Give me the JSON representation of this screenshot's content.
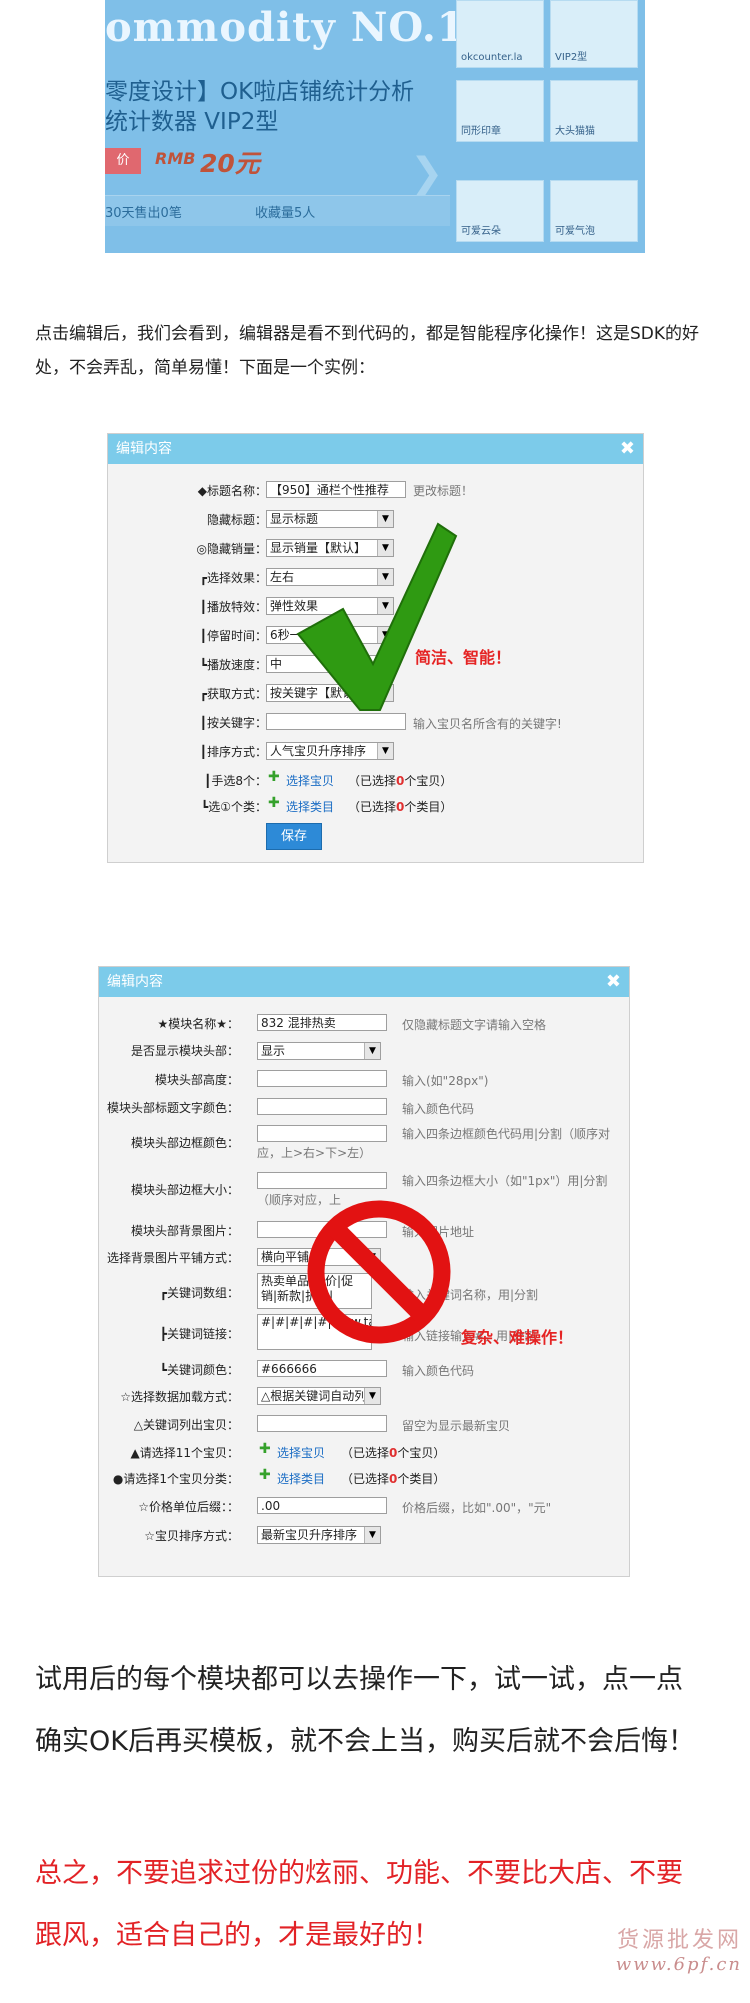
{
  "banner": {
    "title": "ommodity NO.1",
    "subtitle_line1": "零度设计】OK啦店铺统计分析",
    "subtitle_line2": "统计数器 VIP2型",
    "price_tag": "价",
    "price_currency": "RMB",
    "price_value": "20元",
    "sold_text": "30天售出0笔",
    "fav_text": "收藏量5人",
    "thumbs": [
      {
        "label": "okcounter.la"
      },
      {
        "label": "VIP2型"
      },
      {
        "label": "同形印章"
      },
      {
        "label": "大头猫猫"
      },
      {
        "label": "可爱云朵"
      },
      {
        "label": "可爱气泡"
      }
    ]
  },
  "intro_text": "点击编辑后，我们会看到，编辑器是看不到代码的，都是智能程序化操作！这是SDK的好处，不会弄乱，简单易懂！下面是一个实例：",
  "editor1": {
    "header": "编辑内容",
    "close_icon": "close-icon",
    "rows": {
      "title_label": "◆标题名称：",
      "title_value": "【950】通栏个性推荐",
      "title_hint": "更改标题！",
      "hide_title_label": "隐藏标题：",
      "hide_title_value": "显示标题",
      "hide_sales_label": "◎隐藏销量：",
      "hide_sales_value": "显示销量【默认】",
      "effect_label": "┏选择效果：",
      "effect_value": "左右",
      "play_label": "┃播放特效：",
      "play_value": "弹性效果",
      "pause_label": "┃停留时间：",
      "pause_value": "6秒一自",
      "speed_label": "┗播放速度：",
      "speed_value": "中",
      "fetch_label": "┏获取方式：",
      "fetch_value": "按关键字【默认】",
      "keyword_label": "┃按关键字：",
      "keyword_value": "",
      "keyword_hint": "输入宝贝名所含有的关键字!",
      "sort_label": "┃排序方式：",
      "sort_value": "人气宝贝升序排序",
      "pick_items_label": "┃手选8个：",
      "pick_items_link": "选择宝贝",
      "pick_items_count_pre": "（已选择",
      "pick_items_count_num": "0",
      "pick_items_count_post": "个宝贝）",
      "pick_cats_label": "┗选①个类：",
      "pick_cats_link": "选择类目",
      "pick_cats_count_pre": "（已选择",
      "pick_cats_count_num": "0",
      "pick_cats_count_post": "个类目）",
      "save_label": "保存"
    },
    "annotation": "简洁、智能！"
  },
  "editor2": {
    "header": "编辑内容",
    "close_icon": "close-icon",
    "rows": {
      "module_name_label": "★模块名称★：",
      "module_name_value": "832 混排热卖",
      "module_name_hint": "仅隐藏标题文字请输入空格",
      "show_head_label": "是否显示模块头部：",
      "show_head_value": "显示",
      "head_height_label": "模块头部高度：",
      "head_height_value": "",
      "head_height_hint": "输入(如\"28px\")",
      "title_color_label": "模块头部标题文字颜色：",
      "title_color_value": "",
      "title_color_hint": "输入颜色代码",
      "border_color_label": "模块头部边框颜色：",
      "border_color_value": "",
      "border_color_hint": "输入四条边框颜色代码用|分割（顺序对应，上>右>下>左）",
      "border_size_label": "模块头部边框大小：",
      "border_size_value": "",
      "border_size_hint": "输入四条边框大小（如\"1px\"）用|分割（顺序对应，上",
      "bg_image_label": "模块头部背景图片：",
      "bg_image_value": "",
      "bg_image_hint": "输入图片地址",
      "bg_tile_label": "选择背景图片平铺方式：",
      "bg_tile_value": "横向平铺",
      "kw_group_label": "┏关键词数组：",
      "kw_group_value": "热卖单品|特价|促销|新款|折扣|",
      "kw_group_hint": "输入关键词名称，用|分割",
      "kw_link_label": "┣关键词链接：",
      "kw_link_value": "#|#|#|#|#|www.taobao.c",
      "kw_link_hint": "输入链接输入#，用|分割",
      "kw_color_label": "┗关键词颜色：",
      "kw_color_value": "#666666",
      "kw_color_hint": "输入颜色代码",
      "load_label": "☆选择数据加载方式：",
      "load_value": "△根据关键词自动列",
      "list_kw_label": "△关键词列出宝贝：",
      "list_kw_value": "",
      "list_kw_hint": "留空为显示最新宝贝",
      "pick_items_label": "▲请选择11个宝贝：",
      "pick_items_link": "选择宝贝",
      "pick_items_count_pre": "（已选择",
      "pick_items_count_num": "0",
      "pick_items_count_post": "个宝贝）",
      "pick_cat_label": "●请选择1个宝贝分类：",
      "pick_cat_link": "选择类目",
      "pick_cat_count_pre": "（已选择",
      "pick_cat_count_num": "0",
      "pick_cat_count_post": "个类目）",
      "price_suffix_label": "☆价格单位后缀：：",
      "price_suffix_value": ".00",
      "price_suffix_hint": "价格后缀，比如\".00\"，\"元\"",
      "sort_label": "☆宝贝排序方式：",
      "sort_value": "最新宝贝升序排序"
    },
    "annotation": "复杂、难操作！"
  },
  "closing": {
    "line1": "试用后的每个模块都可以去操作一下，试一试，点一点",
    "line2": "确实OK后再买模板，就不会上当，购买后就不会后悔！",
    "red_line1": "总之，不要追求过份的炫丽、功能、不要比大店、不要",
    "red_line2": "跟风，适合自己的，才是最好的！"
  },
  "watermark": {
    "line1": "货源批发网",
    "line2": "www.6pf.cn"
  }
}
